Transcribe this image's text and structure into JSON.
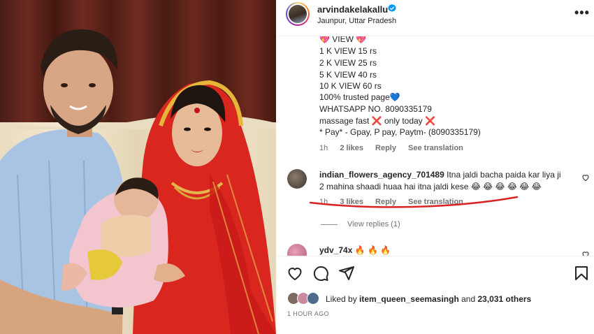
{
  "post": {
    "username": "arvindakelakallu",
    "location": "Jaunpur, Uttar Pradesh"
  },
  "caption_lines": [
    "💖 VIEW 💖",
    "1 K VIEW 15 rs",
    "2 K VIEW 25 rs",
    "5 K VIEW 40 rs",
    "10 K VIEW 60 rs",
    "100% trusted page💙",
    "WHATSAPP NO. 8090335179",
    "massage fast ❌ only today ❌",
    "* Pay* - Gpay, P pay, Paytm- (8090335179)"
  ],
  "caption_meta": {
    "time": "1h",
    "likes": "2 likes",
    "reply": "Reply",
    "translate": "See translation"
  },
  "comment": {
    "username": "indian_flowers_agency_701489",
    "text_line1": "Itna jaldi bacha paida kar liya ji",
    "text_line2": "2 mahina shaadi huaa hai itna jaldi kese 😂 😂 😂 😂 😂 😂",
    "time": "1h",
    "likes": "3 likes",
    "reply": "Reply",
    "translate": "See translation",
    "view_replies": "View replies (1)"
  },
  "next_comment": {
    "username": "ydv_74x",
    "text": "🔥 🔥 🔥"
  },
  "likes": {
    "prefix": "Liked by",
    "user": "item_queen_seemasingh",
    "and": "and",
    "others": "23,031 others"
  },
  "timestamp": "1 HOUR AGO",
  "icons": [
    "heart-icon",
    "comment-icon",
    "share-icon",
    "bookmark-icon",
    "verified-icon",
    "more-icon"
  ],
  "colors": {
    "verified": "#0095f6",
    "underline": "#d92323",
    "muted": "#737373"
  }
}
